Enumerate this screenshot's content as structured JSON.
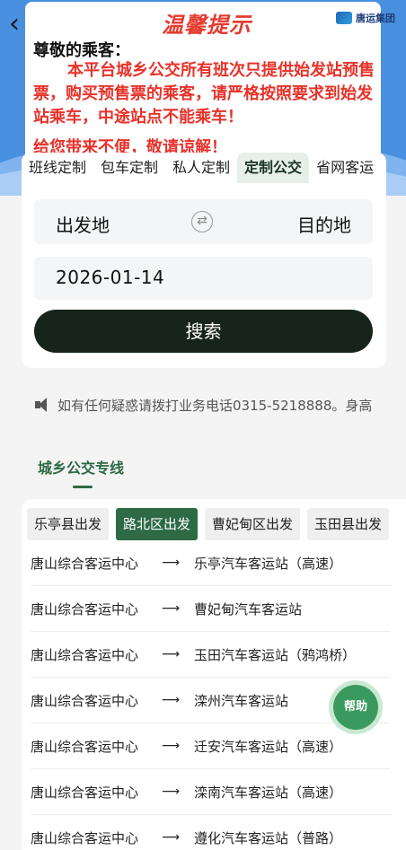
{
  "header": {
    "logo_text": "温馨提示",
    "company_name": "唐运集团"
  },
  "notice": {
    "greeting": "尊敬的乘客：",
    "body": "本平台城乡公交所有班次只提供始发站预售票，购买预售票的乘客，请严格按照要求到始发站乘车，中途站点不能乘车！",
    "apology": "给您带来不便，敬请谅解！"
  },
  "tabs": [
    {
      "label": "班线定制"
    },
    {
      "label": "包车定制"
    },
    {
      "label": "私人定制"
    },
    {
      "label": "定制公交"
    },
    {
      "label": "省网客运"
    }
  ],
  "active_tab": "定制公交",
  "search": {
    "from_placeholder": "出发地",
    "to_placeholder": "目的地",
    "date": "2026-01-14",
    "button_label": "搜索"
  },
  "announcement": "如有任何疑惑请拨打业务电话0315-5218888。身高",
  "section": {
    "title": "城乡公交专线"
  },
  "regions": [
    {
      "label": "乐亭县出发"
    },
    {
      "label": "路北区出发"
    },
    {
      "label": "曹妃甸区出发"
    },
    {
      "label": "玉田县出发"
    }
  ],
  "active_region": "路北区出发",
  "routes": [
    {
      "origin": "唐山综合客运中心",
      "arrow": "⟶",
      "destination": "乐亭汽车客运站（高速）"
    },
    {
      "origin": "唐山综合客运中心",
      "arrow": "⟶",
      "destination": "曹妃甸汽车客运站"
    },
    {
      "origin": "唐山综合客运中心",
      "arrow": "⟶",
      "destination": "玉田汽车客运站（鸦鸿桥）"
    },
    {
      "origin": "唐山综合客运中心",
      "arrow": "⟶",
      "destination": "滦州汽车客运站"
    },
    {
      "origin": "唐山综合客运中心",
      "arrow": "⟶",
      "destination": "迁安汽车客运站（高速）"
    },
    {
      "origin": "唐山综合客运中心",
      "arrow": "⟶",
      "destination": "滦南汽车客运站（高速）"
    },
    {
      "origin": "唐山综合客运中心",
      "arrow": "⟶",
      "destination": "遵化汽车客运站（普路）"
    }
  ],
  "help_label": "帮助",
  "colors": {
    "brand_green": "#2d6a45",
    "notice_red": "#e8322a",
    "banner_blue": "#4a90e0",
    "search_button": "#17241c"
  }
}
